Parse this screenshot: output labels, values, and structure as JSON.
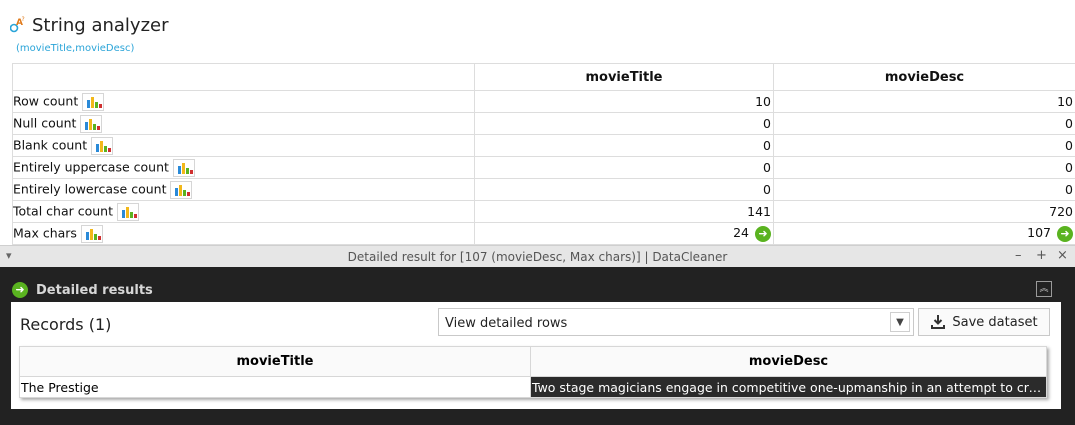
{
  "header": {
    "title": "String analyzer",
    "subtitle": "(movieTitle,movieDesc)"
  },
  "results": {
    "columns": [
      "movieTitle",
      "movieDesc"
    ],
    "rows": [
      {
        "label": "Row count",
        "values": [
          "10",
          "10"
        ]
      },
      {
        "label": "Null count",
        "values": [
          "0",
          "0"
        ]
      },
      {
        "label": "Blank count",
        "values": [
          "0",
          "0"
        ]
      },
      {
        "label": "Entirely uppercase count",
        "values": [
          "0",
          "0"
        ]
      },
      {
        "label": "Entirely lowercase count",
        "values": [
          "0",
          "0"
        ]
      },
      {
        "label": "Total char count",
        "values": [
          "141",
          "720"
        ]
      },
      {
        "label": "Max chars",
        "values": [
          "24",
          "107"
        ]
      }
    ]
  },
  "detail_window": {
    "title": "Detailed result for [107 (movieDesc, Max chars)] | DataCleaner",
    "heading": "Detailed results",
    "records_label": "Records (1)",
    "view_select": "View detailed rows",
    "save_label": "Save dataset",
    "columns": [
      "movieTitle",
      "movieDesc"
    ],
    "rows": [
      [
        "The Prestige",
        "Two stage magicians engage in competitive one-upmanship in an attempt to cre..."
      ]
    ]
  },
  "colors": {
    "accent_green": "#5ab320",
    "subtitle_blue": "#2aa4d8",
    "dark_bg": "#222222",
    "selected_cell": "#2b2b2b"
  }
}
